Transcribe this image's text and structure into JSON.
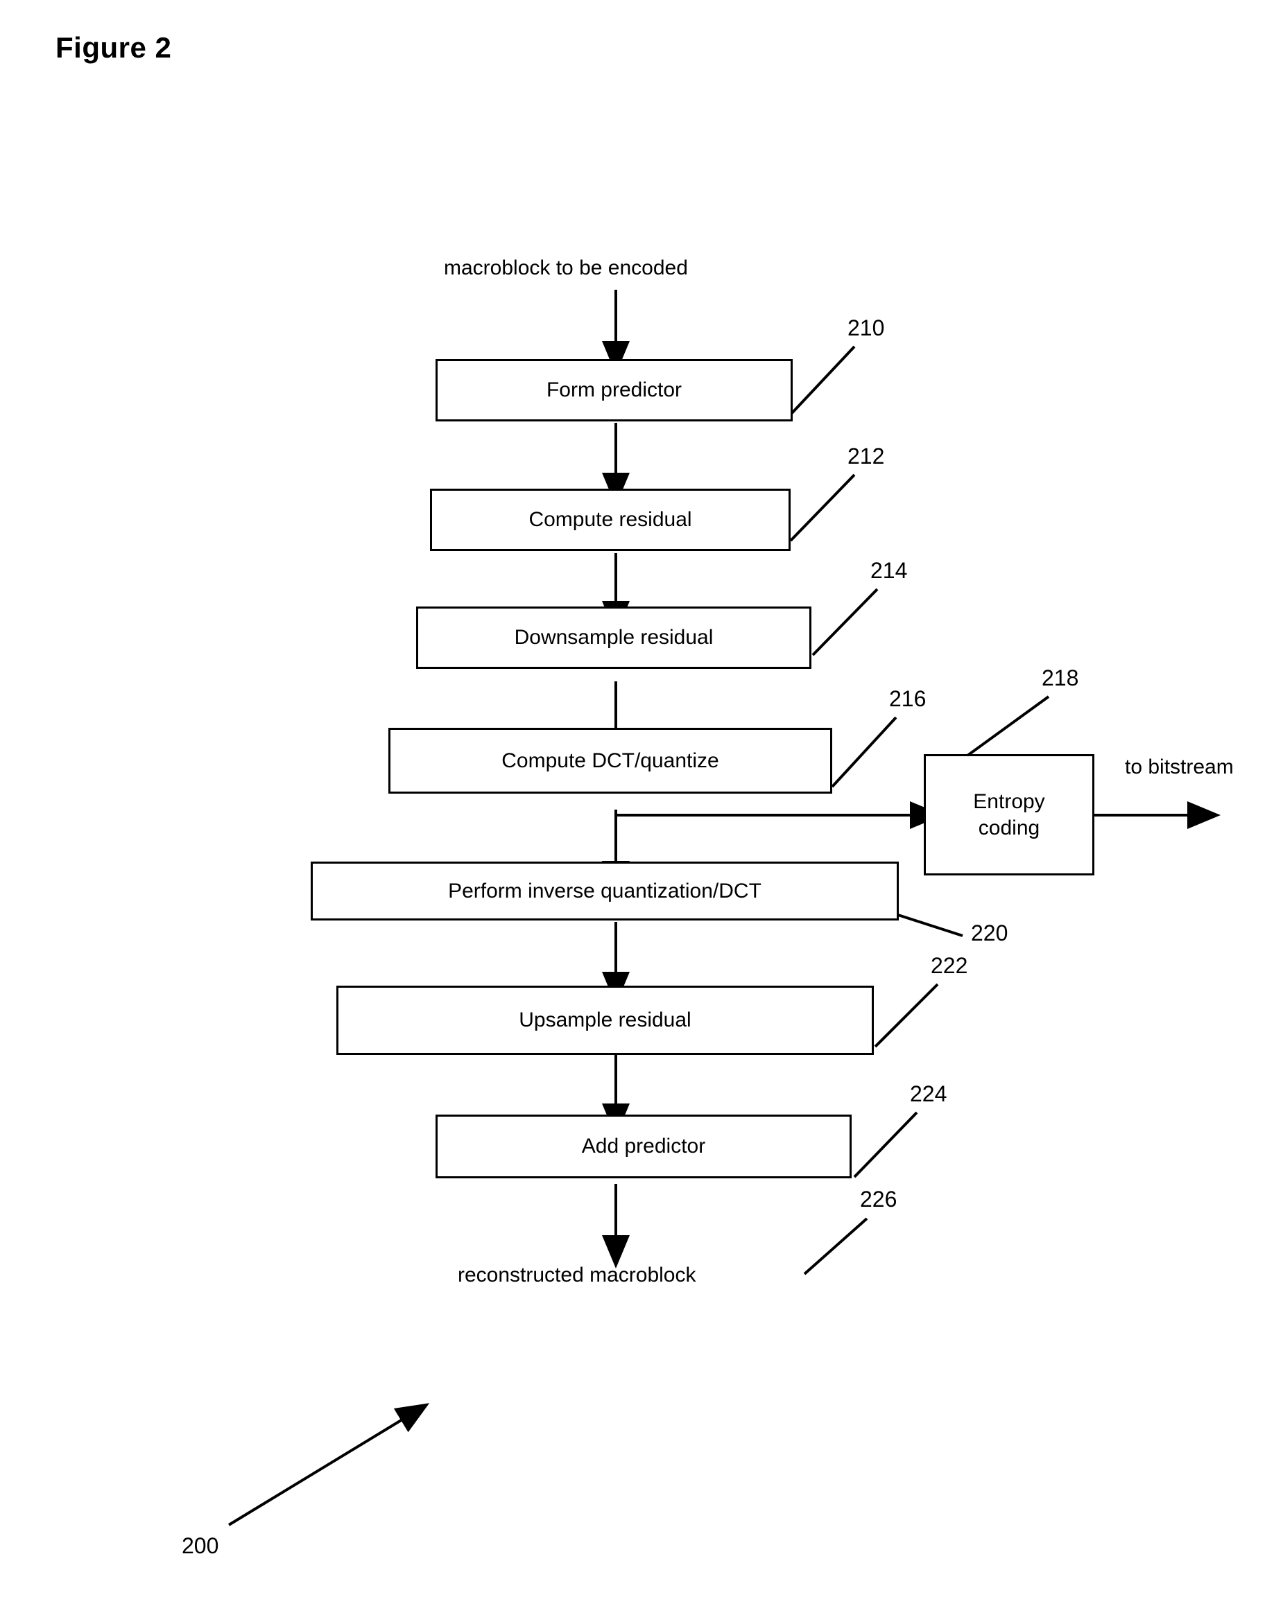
{
  "figure": {
    "title": "Figure 2",
    "overall_ref": "200"
  },
  "labels": {
    "input": "macroblock to be encoded",
    "output": "reconstructed macroblock",
    "bitstream": "to bitstream"
  },
  "nodes": [
    {
      "id": "form-predictor",
      "label": "Form predictor",
      "ref": "210"
    },
    {
      "id": "compute-residual",
      "label": "Compute residual",
      "ref": "212"
    },
    {
      "id": "downsample-residual",
      "label": "Downsample residual",
      "ref": "214"
    },
    {
      "id": "compute-dct-quantize",
      "label": "Compute DCT/quantize",
      "ref": "216"
    },
    {
      "id": "entropy-coding",
      "label": "Entropy coding",
      "ref": "218"
    },
    {
      "id": "inverse-quantization-dct",
      "label": "Perform inverse quantization/DCT",
      "ref": "220"
    },
    {
      "id": "upsample-residual",
      "label": "Upsample residual",
      "ref": "222"
    },
    {
      "id": "add-predictor",
      "label": "Add predictor",
      "ref": "224"
    }
  ],
  "output_ref": "226"
}
